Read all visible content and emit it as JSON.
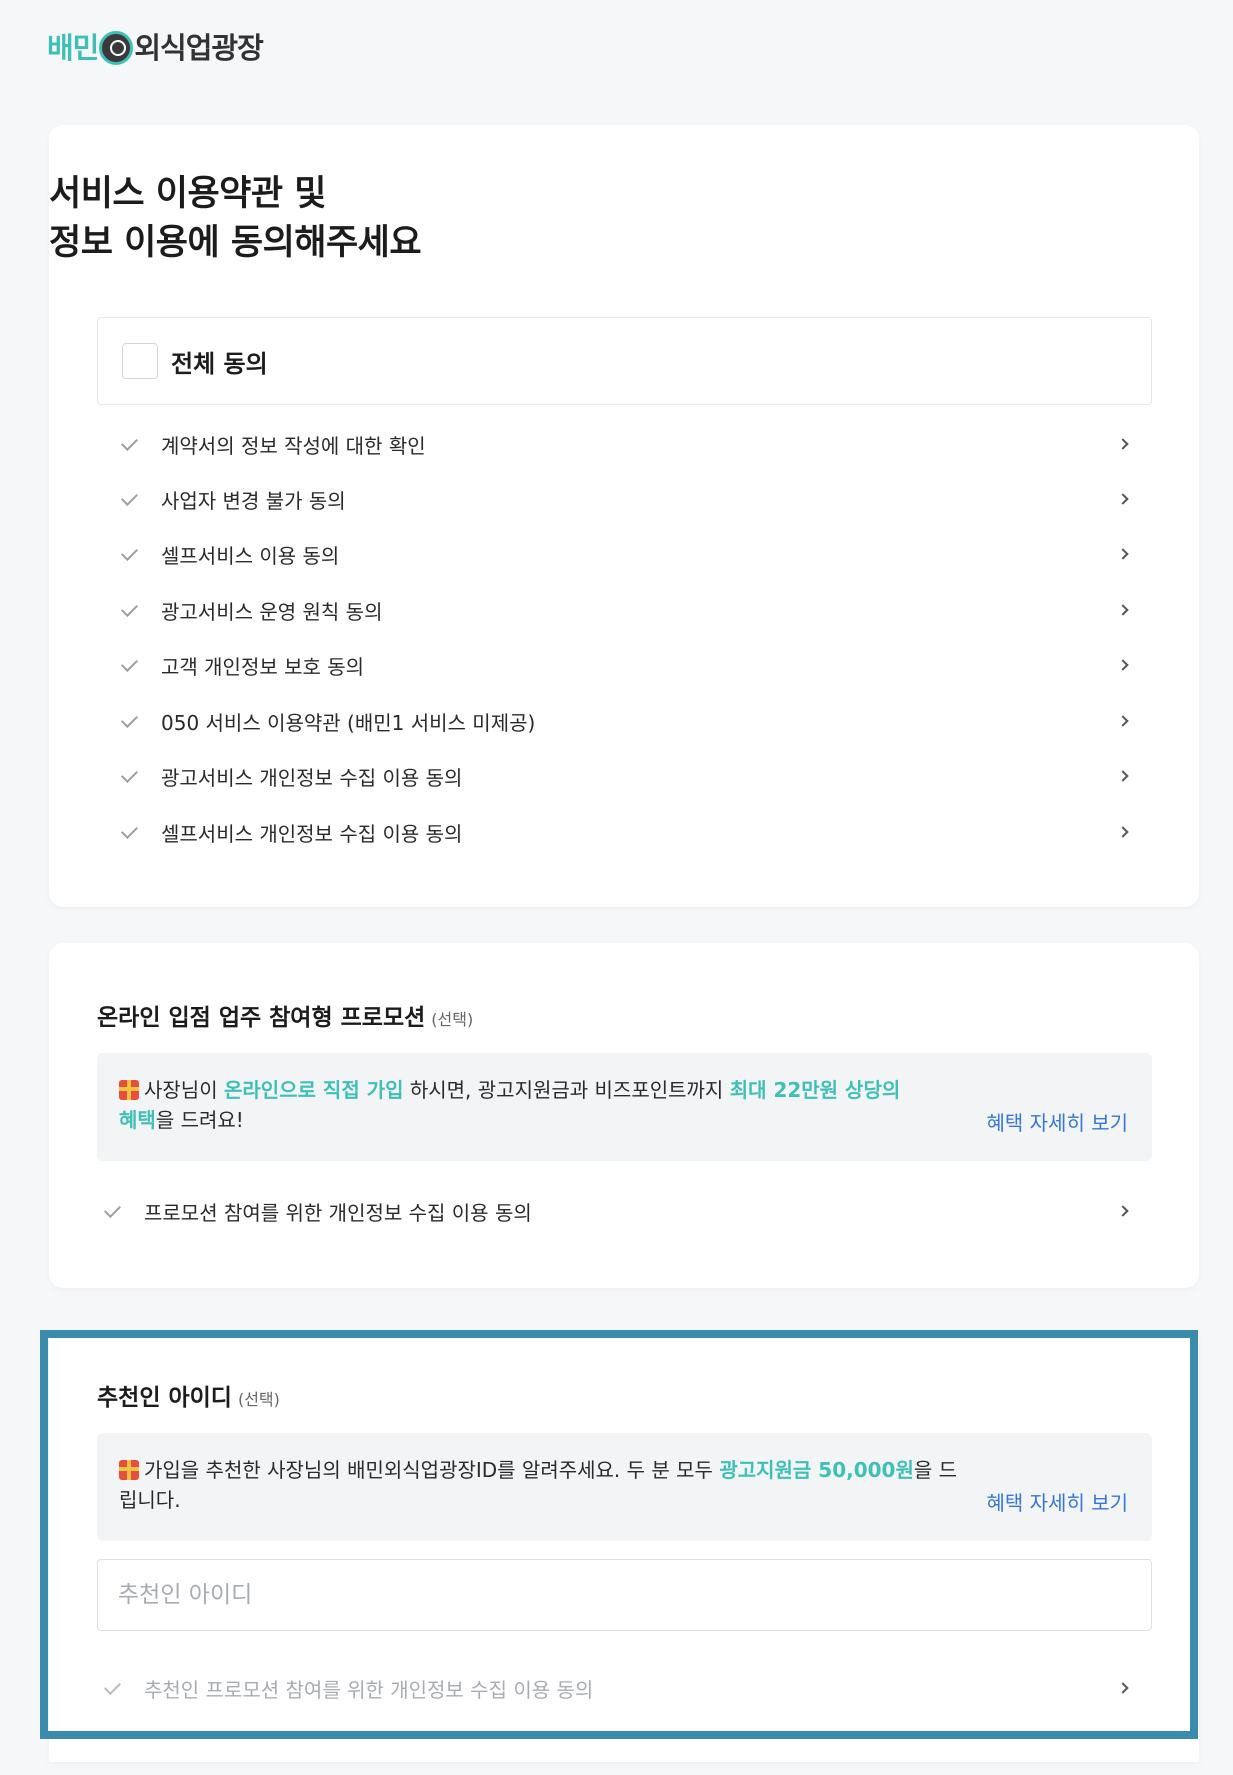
{
  "logo": {
    "part1": "배민",
    "part2": "외식업광장"
  },
  "terms": {
    "title_line1": "서비스 이용약관 및",
    "title_line2": "정보 이용에 동의해주세요",
    "agree_all": "전체 동의",
    "items": [
      {
        "label": "계약서의 정보 작성에 대한 확인"
      },
      {
        "label": "사업자 변경 불가 동의"
      },
      {
        "label": "셀프서비스 이용 동의"
      },
      {
        "label": "광고서비스 운영 원칙 동의"
      },
      {
        "label": "고객 개인정보 보호 동의"
      },
      {
        "label": "050 서비스 이용약관 (배민1 서비스 미제공)"
      },
      {
        "label": "광고서비스 개인정보 수집 이용 동의"
      },
      {
        "label": "셀프서비스 개인정보 수집 이용 동의"
      }
    ]
  },
  "promotion": {
    "title": "온라인 입점 업주 참여형 프로모션",
    "optional": "(선택)",
    "text_a": "사장님이 ",
    "text_hl1": "온라인으로 직접 가입",
    "text_b": " 하시면, 광고지원금과 비즈포인트까지 ",
    "text_hl2": "최대 22만원 상당의 혜택",
    "text_c": "을 드려요!",
    "benefit_link": "혜택 자세히 보기",
    "consent": "프로모션 참여를 위한 개인정보 수집 이용 동의"
  },
  "referral": {
    "title": "추천인 아이디",
    "optional": "(선택)",
    "text_a": "가입을 추천한 사장님의 배민외식업광장ID를 알려주세요. 두 분 모두 ",
    "text_hl": "광고지원금 50,000원",
    "text_b": "을 드립니다.",
    "benefit_link": "혜택 자세히 보기",
    "input_placeholder": "추천인 아이디",
    "consent": "추천인 프로모션 참여를 위한 개인정보 수집 이용 동의"
  },
  "colors": {
    "accent": "#3fc0b6",
    "link": "#3777d6",
    "highlight_border": "#3b8bad"
  },
  "icons": {
    "check": "check-icon",
    "chevron": "chevron-right-icon",
    "gift": "gift-icon"
  }
}
